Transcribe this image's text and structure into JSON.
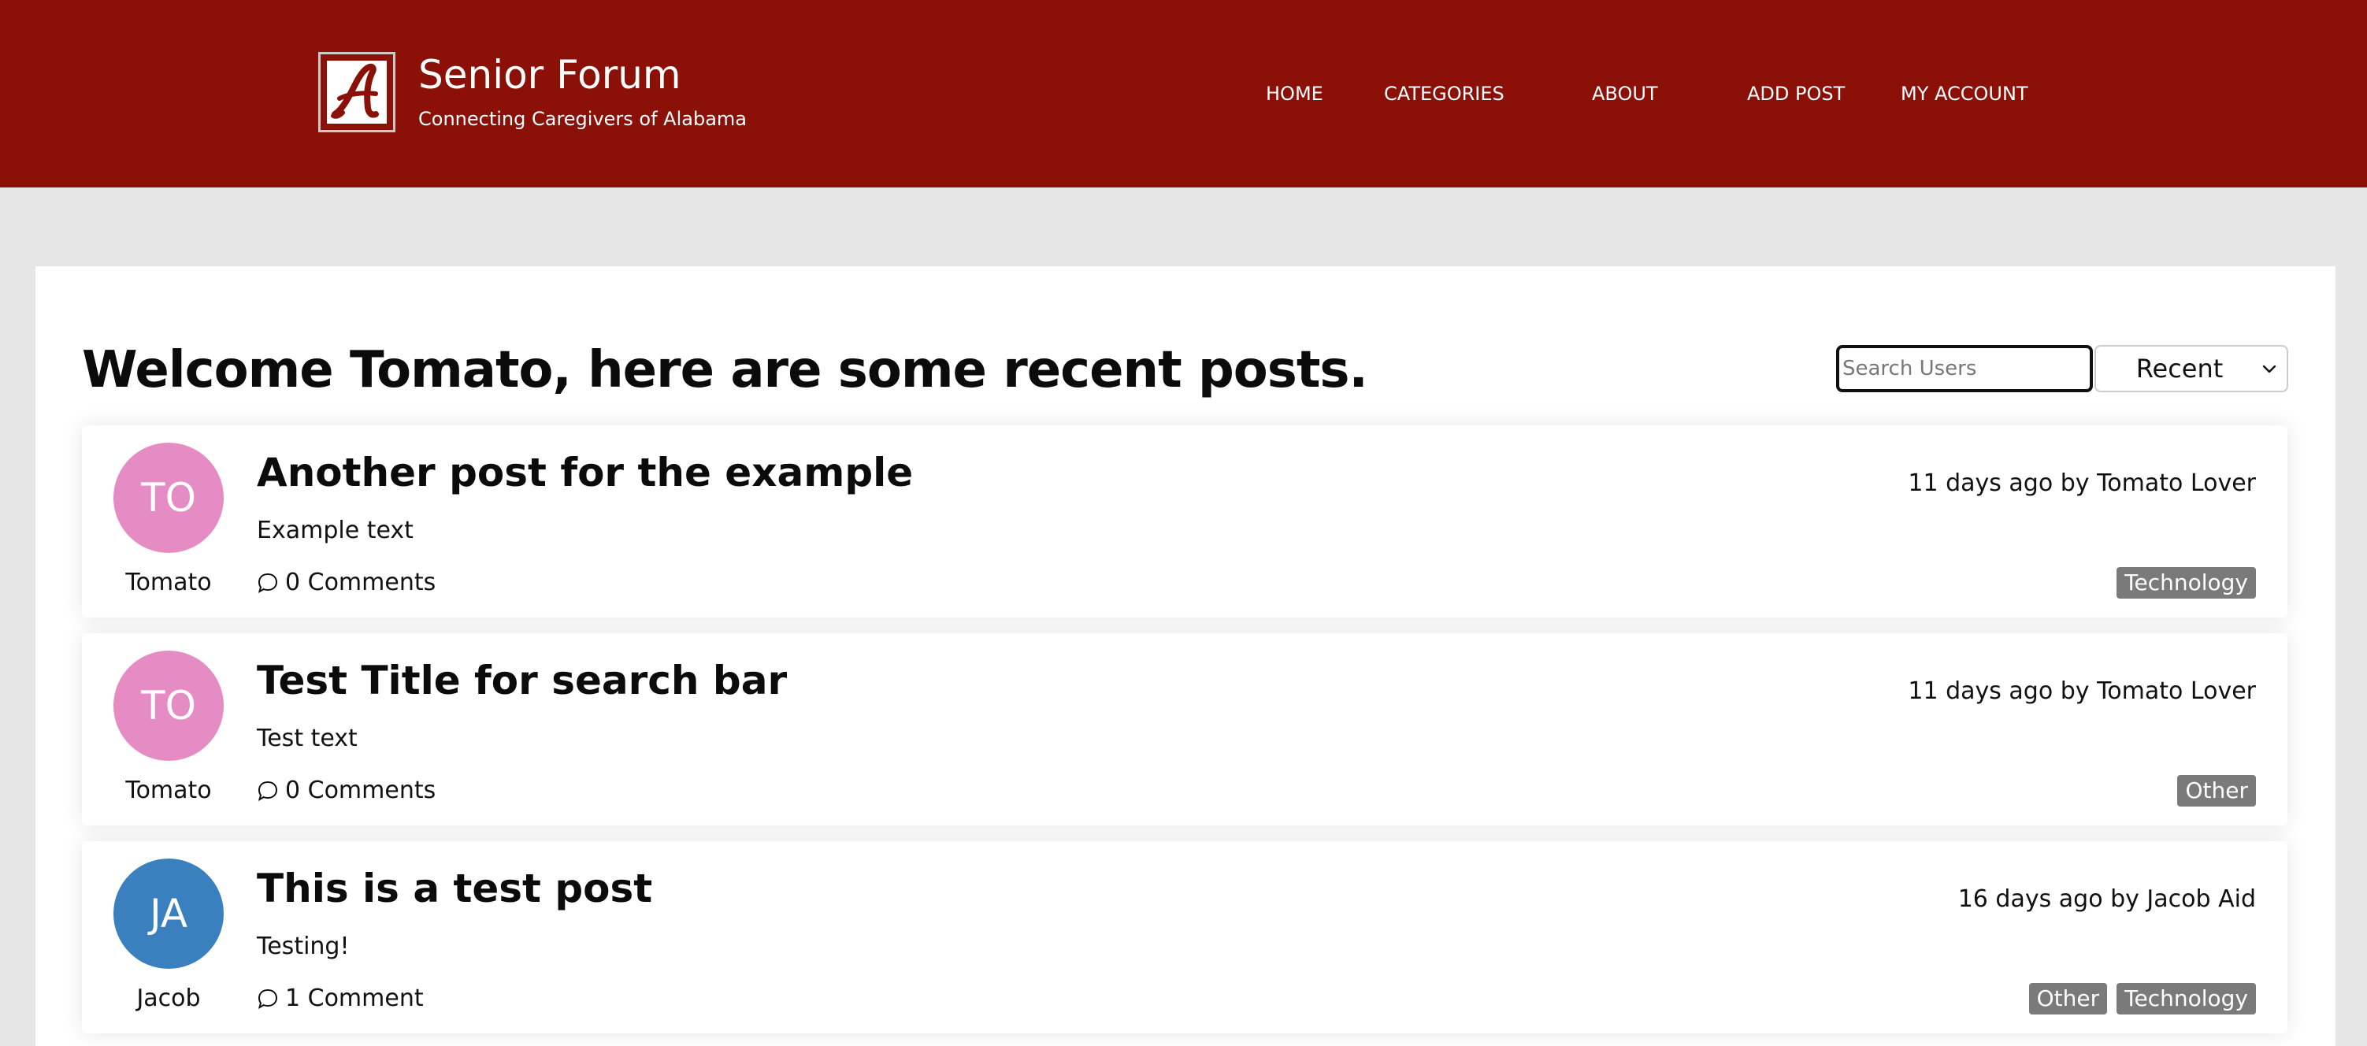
{
  "header": {
    "title": "Senior Forum",
    "subtitle": "Connecting Caregivers of Alabama",
    "logo_icon": "alabama-script-a-logo",
    "nav": [
      "HOME",
      "CATEGORIES",
      "ABOUT",
      "ADD POST",
      "MY ACCOUNT"
    ],
    "background_color": "#8b1008"
  },
  "main": {
    "welcome": "Welcome Tomato, here are some recent posts.",
    "search": {
      "placeholder": "Search Users",
      "value": ""
    },
    "sort": {
      "selected": "Recent",
      "icon": "chevron-down-icon"
    }
  },
  "posts": [
    {
      "avatar_initials": "TO",
      "avatar_color": "#e58cc5",
      "author_first": "Tomato",
      "title": "Another post for the example",
      "body": "Example text",
      "comments": "0 Comments",
      "meta": "11 days ago by Tomato Lover",
      "tags": [
        "Technology"
      ]
    },
    {
      "avatar_initials": "TO",
      "avatar_color": "#e58cc5",
      "author_first": "Tomato",
      "title": "Test Title for search bar",
      "body": "Test text",
      "comments": "0 Comments",
      "meta": "11 days ago by Tomato Lover",
      "tags": [
        "Other"
      ]
    },
    {
      "avatar_initials": "JA",
      "avatar_color": "#3a80bf",
      "author_first": "Jacob",
      "title": "This is a test post",
      "body": "Testing!",
      "comments": "1 Comment",
      "meta": "16 days ago by Jacob Aid",
      "tags": [
        "Other",
        "Technology"
      ]
    }
  ]
}
